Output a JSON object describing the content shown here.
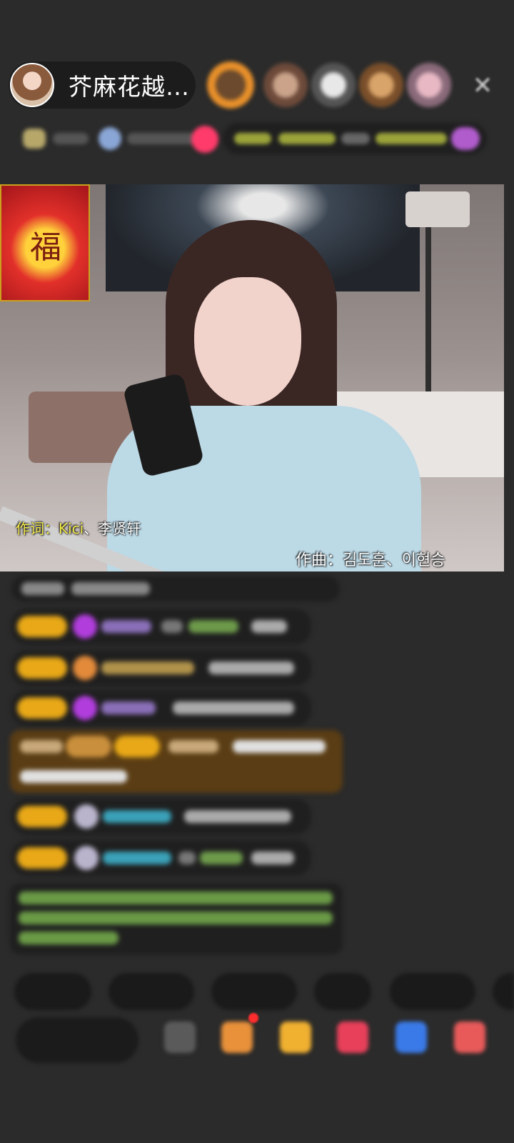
{
  "header": {
    "host_name": "芥麻花越…",
    "close_glyph": "✕"
  },
  "video": {
    "lyric_label_left": "作词：Kici",
    "lyric_names_left": "、李贤轩",
    "lyric_right": "作曲：김도훈、이현승",
    "poster_glyph": "福"
  },
  "colors": {
    "lyric_label": "#f2e84a",
    "badge": "#e8a817",
    "gift_highlight": "#5a3d14"
  }
}
